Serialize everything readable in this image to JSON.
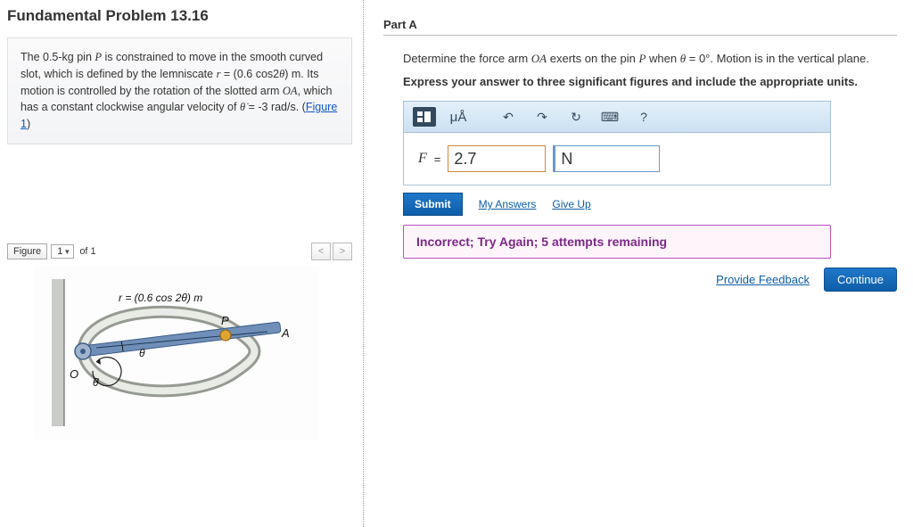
{
  "problem": {
    "title": "Fundamental Problem 13.16",
    "description_html": "The 0.5-kg pin <span class='ital'>P</span> is constrained to move in the smooth curved slot, which is defined by the lemniscate <span class='ital'>r</span> = (0.6 cos2<span class='ital'>θ</span>) m. Its motion is controlled by the rotation of the slotted arm <span class='ital'>OA</span>, which has a constant clockwise angular velocity of <span class='ital'>θ̇</span> = -3 rad/s. (<span class='lnk'>Figure 1</span>)"
  },
  "figure": {
    "label": "Figure",
    "selected": "1",
    "of": "of 1",
    "prev": "<",
    "next": ">",
    "curve_label": "r = (0.6 cos 2θ) m",
    "pt_P": "P",
    "pt_A": "A",
    "pt_O": "O",
    "angle": "θ",
    "rate": "θ̇"
  },
  "partA": {
    "header": "Part A",
    "prompt_html": "Determine the force arm <span class='ital'>OA</span> exerts on the pin <span class='ital'>P</span> when <span class='ital'>θ</span> = 0°. Motion is in the vertical plane.",
    "instruction": "Express your answer to three significant figures and include the appropriate units.",
    "toolbar": {
      "template": "tmpl",
      "units_label": "μÅ",
      "undo": "↶",
      "redo": "↷",
      "reset": "↻",
      "keyboard": "⌨",
      "help": "?"
    },
    "answer": {
      "var": "F",
      "eq": "=",
      "value": "2.7",
      "unit": "N"
    },
    "actions": {
      "submit": "Submit",
      "my_answers": "My Answers",
      "give_up": "Give Up"
    },
    "feedback": "Incorrect; Try Again; 5 attempts remaining"
  },
  "footer": {
    "provide_feedback": "Provide Feedback",
    "continue": "Continue"
  }
}
